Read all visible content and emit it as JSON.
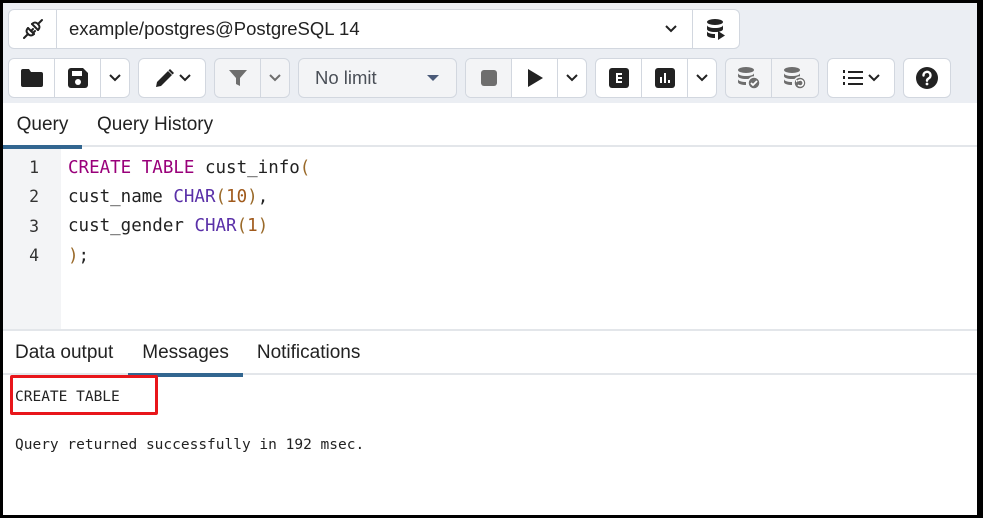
{
  "connection": {
    "label": "example/postgres@PostgreSQL 14",
    "icons": {
      "connection": "plug-connected-icon",
      "dropdown": "chevron-down-icon",
      "execute_scripts": "database-play-icon"
    }
  },
  "toolbar": {
    "open_file": "folder-icon",
    "save_file": "save-icon",
    "save_menu": "chevron-down-icon",
    "edit": "pencil-icon",
    "filter": "filter-icon",
    "filter_menu": "chevron-down-icon",
    "limit_label": "No limit",
    "stop": "stop-icon",
    "execute": "play-icon",
    "execute_menu": "chevron-down-icon",
    "explain": "explain-e-icon",
    "explain_analyze": "bar-chart-icon",
    "explain_menu": "chevron-down-icon",
    "commit": "database-check-icon",
    "rollback": "database-undo-icon",
    "macros": "numbered-list-icon",
    "help": "help-circle-icon"
  },
  "editor": {
    "tabs": [
      {
        "label": "Query",
        "active": true
      },
      {
        "label": "Query History",
        "active": false
      }
    ],
    "lines": [
      {
        "number": "1",
        "tokens": [
          {
            "t": "CREATE TABLE",
            "c": "kw"
          },
          {
            "t": " cust_info",
            "c": ""
          },
          {
            "t": "(",
            "c": "paren"
          }
        ]
      },
      {
        "number": "2",
        "tokens": [
          {
            "t": "cust_name ",
            "c": ""
          },
          {
            "t": "CHAR",
            "c": "type"
          },
          {
            "t": "(",
            "c": "paren"
          },
          {
            "t": "10",
            "c": "num"
          },
          {
            "t": ")",
            "c": "paren"
          },
          {
            "t": ",",
            "c": ""
          }
        ]
      },
      {
        "number": "3",
        "tokens": [
          {
            "t": "cust_gender ",
            "c": ""
          },
          {
            "t": "CHAR",
            "c": "type"
          },
          {
            "t": "(",
            "c": "paren"
          },
          {
            "t": "1",
            "c": "num"
          },
          {
            "t": ")",
            "c": "paren"
          }
        ]
      },
      {
        "number": "4",
        "tokens": [
          {
            "t": ")",
            "c": "paren"
          },
          {
            "t": ";",
            "c": ""
          }
        ]
      }
    ]
  },
  "output": {
    "tabs": [
      {
        "label": "Data output",
        "active": false
      },
      {
        "label": "Messages",
        "active": true
      },
      {
        "label": "Notifications",
        "active": false
      }
    ],
    "message_command": "CREATE TABLE",
    "message_result": "Query returned successfully in 192 msec.",
    "highlight_color": "#e8161b"
  },
  "colors": {
    "accent": "#326690",
    "keyword": "#99007a",
    "type": "#5a30a8",
    "number": "#a05a1c"
  }
}
